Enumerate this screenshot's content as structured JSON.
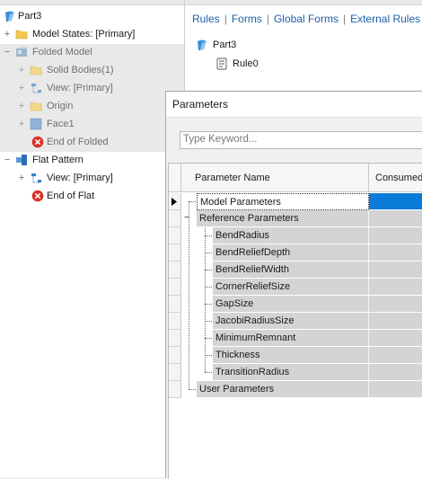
{
  "browser": {
    "items": [
      {
        "label": "Part3"
      },
      {
        "label": "Model States: [Primary]"
      },
      {
        "label": "Folded Model"
      },
      {
        "label": "Solid Bodies(1)"
      },
      {
        "label": "View: [Primary]"
      },
      {
        "label": "Origin"
      },
      {
        "label": "Face1"
      },
      {
        "label": "End of Folded"
      },
      {
        "label": "Flat Pattern"
      },
      {
        "label": "View: [Primary]"
      },
      {
        "label": "End of Flat"
      }
    ]
  },
  "rules": {
    "tabs": [
      "Rules",
      "Forms",
      "Global Forms",
      "External Rules"
    ],
    "tree": {
      "part": "Part3",
      "rule": "Rule0"
    }
  },
  "dialog": {
    "title": "Parameters",
    "search_placeholder": "Type Keyword...",
    "columns": [
      "Parameter Name",
      "Consumed b"
    ],
    "rows": [
      "Model Parameters",
      "Reference Parameters",
      "BendRadius",
      "BendReliefDepth",
      "BendReliefWidth",
      "CornerReliefSize",
      "GapSize",
      "JacobiRadiusSize",
      "MinimumRemnant",
      "Thickness",
      "TransitionRadius",
      "User Parameters"
    ]
  },
  "colors": {
    "accent": "#0a7bd8",
    "link": "#1c5fa8",
    "error": "#d93025",
    "folder": "#f2c94c"
  }
}
